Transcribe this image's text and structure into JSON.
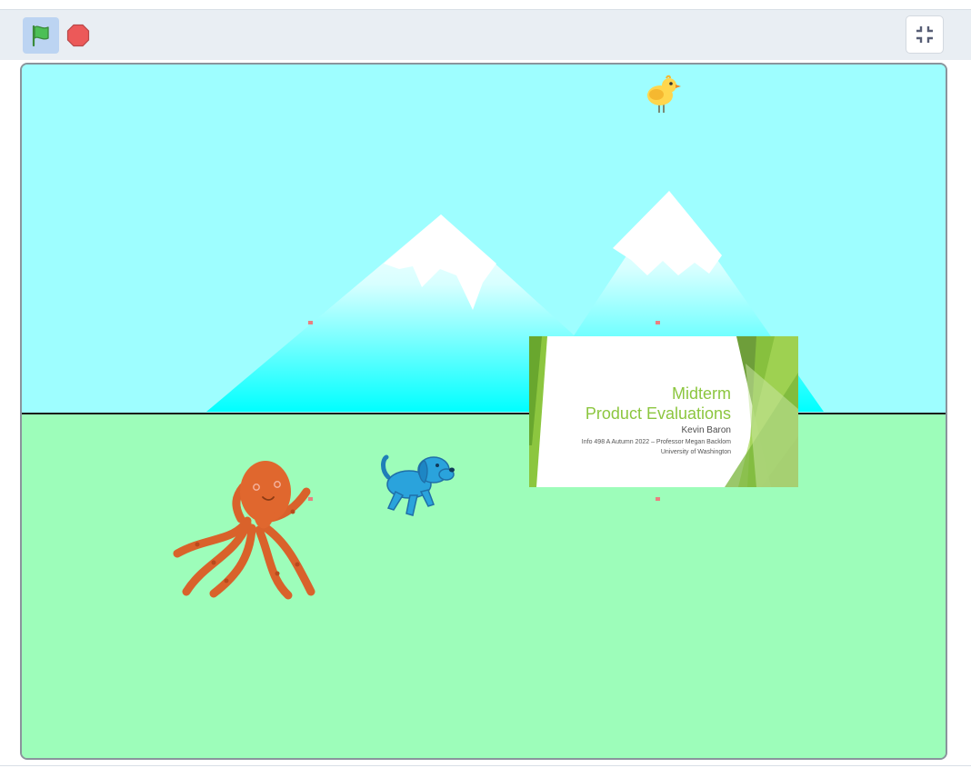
{
  "toolbar": {
    "green_flag": "green-flag-icon",
    "stop": "stop-icon",
    "fullscreen": "exit-fullscreen-icon"
  },
  "stage": {
    "backdrop": {
      "sky_color": "#9efeff",
      "ground_color": "#9dfdba",
      "mountain_color": "#00ffff"
    },
    "sprites": {
      "chick": "chick-sprite",
      "octopus": "octopus-sprite",
      "dog": "dog-sprite"
    },
    "slide": {
      "title_line1": "Midterm",
      "title_line2": "Product Evaluations",
      "author": "Kevin Baron",
      "course_line": "Info 498 A Autumn 2022 – Professor Megan Backlom",
      "university": "University of Washington",
      "accent": "#8cc63f"
    }
  }
}
